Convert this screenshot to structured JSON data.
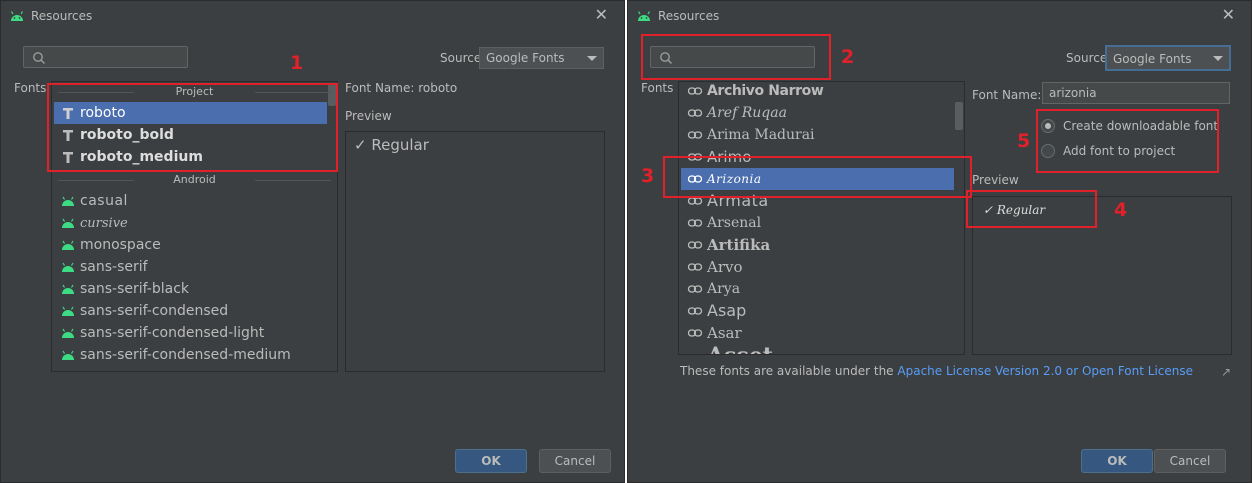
{
  "left": {
    "title": "Resources",
    "source_label": "Source",
    "source_value": "Google Fonts",
    "fonts_label": "Fonts",
    "project_header": "Project",
    "project_fonts": [
      "roboto",
      "roboto_bold",
      "roboto_medium"
    ],
    "android_header": "Android",
    "android_fonts": [
      "casual",
      "cursive",
      "monospace",
      "sans-serif",
      "sans-serif-black",
      "sans-serif-condensed",
      "sans-serif-condensed-light",
      "sans-serif-condensed-medium"
    ],
    "font_name_label": "Font Name: roboto",
    "preview_label": "Preview",
    "preview_style": "✓ Regular",
    "ok": "OK",
    "cancel": "Cancel",
    "annotation": "1"
  },
  "right": {
    "title": "Resources",
    "source_label": "Source",
    "source_value": "Google Fonts",
    "fonts_label": "Fonts",
    "font_list": [
      "Archivo Narrow",
      "Aref Ruqaa",
      "Arima Madurai",
      "Arimo",
      "Arizonia",
      "Armata",
      "Arsenal",
      "Artifika",
      "Arvo",
      "Arya",
      "Asap",
      "Asar",
      "Asset"
    ],
    "selected_font": "Arizonia",
    "font_name_label": "Font Name:",
    "font_name_value": "arizonia",
    "radio_downloadable": "Create downloadable font",
    "radio_add": "Add font to project",
    "preview_label": "Preview",
    "preview_style": "✓ Regular",
    "license_prefix": "These fonts are available under the ",
    "license_link": "Apache License Version 2.0 or Open Font License",
    "external_glyph": "↗",
    "ok": "OK",
    "cancel": "Cancel",
    "annotations": [
      "2",
      "3",
      "4",
      "5"
    ]
  },
  "colors": {
    "dialog_bg": "#3c3f41",
    "selection": "#4b6eaf",
    "highlight": "#e0212a",
    "android_green": "#3ddc84"
  }
}
